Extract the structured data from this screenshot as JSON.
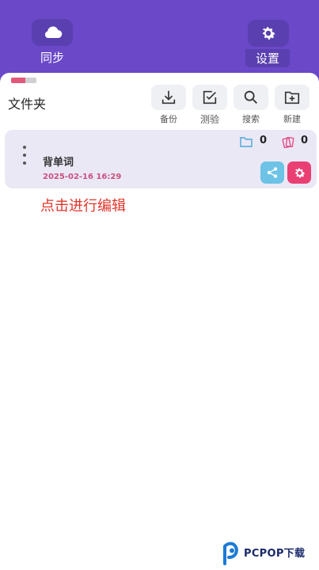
{
  "header": {
    "sync_label": "同步",
    "settings_label": "设置",
    "sync_icon": "cloud-icon",
    "settings_icon": "gear-icon"
  },
  "progress": {
    "value": 0.55,
    "fill_color": "#e2577a"
  },
  "toolbar": {
    "folder_title": "文件夹",
    "backup_label": "备份",
    "test_label": "测验",
    "search_label": "搜索",
    "new_label": "新建"
  },
  "item": {
    "title": "背单词",
    "date": "2025-02-16 16:29",
    "folder_count": "0",
    "card_count": "0"
  },
  "hint": "点击进行编辑",
  "watermark": {
    "text": "PCPOP下载"
  },
  "colors": {
    "header_bg": "#6a48c8",
    "accent_pink": "#ea3f73",
    "accent_blue": "#6cc3e6",
    "hint_red": "#e0342a"
  }
}
